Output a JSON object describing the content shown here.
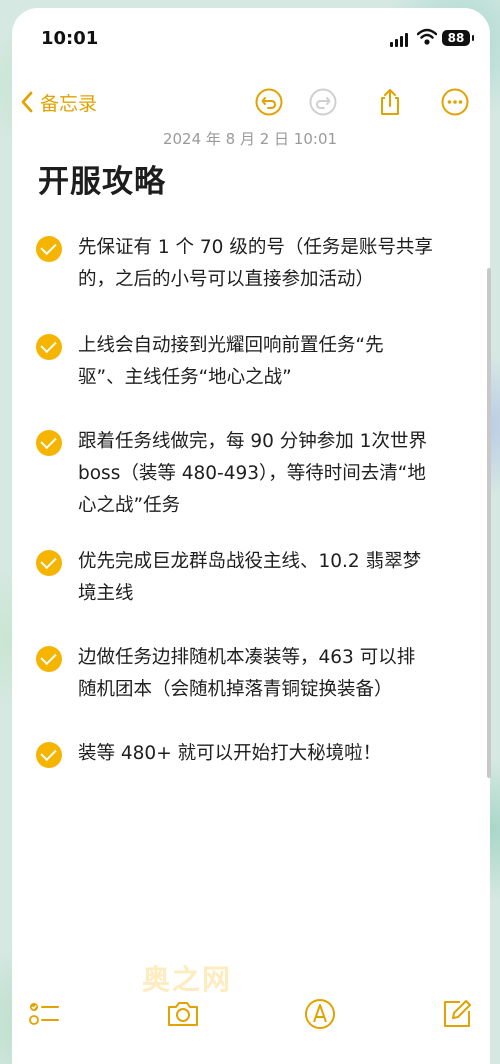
{
  "status_bar": {
    "time": "10:01",
    "battery": "88"
  },
  "nav": {
    "back_label": "备忘录"
  },
  "note": {
    "date": "2024 年 8 月 2 日 10:01",
    "title": "开服攻略",
    "items": [
      {
        "lines": [
          "先保证有 1 个 70 级的号（任务是账号共享",
          "的，之后的小号可以直接参加活动）"
        ]
      },
      {
        "lines": [
          "上线会自动接到光耀回响前置任务“先",
          "驱”、主线任务“地心之战”"
        ]
      },
      {
        "lines": [
          "跟着任务线做完，每 90 分钟参加 1次世界",
          "boss（装等 480-493），等待时间去清“地",
          "心之战”任务"
        ]
      },
      {
        "lines": [
          "优先完成巨龙群岛战役主线、10.2 翡翠梦",
          "境主线"
        ]
      },
      {
        "lines": [
          "边做任务边排随机本凑装等，463 可以排",
          "随机团本（会随机掉落青铜锭换装备）"
        ]
      },
      {
        "lines": [
          "装等 480+ 就可以开始打大秘境啦！"
        ]
      }
    ]
  },
  "watermark": "奥之网",
  "colors": {
    "accent": "#f4b400",
    "text": "#1f1f1f",
    "date": "#9a9a9a"
  },
  "icons": [
    "chevron-left-icon",
    "undo-icon",
    "redo-icon",
    "share-icon",
    "more-icon",
    "checklist-icon",
    "camera-icon",
    "markup-icon",
    "compose-icon"
  ]
}
